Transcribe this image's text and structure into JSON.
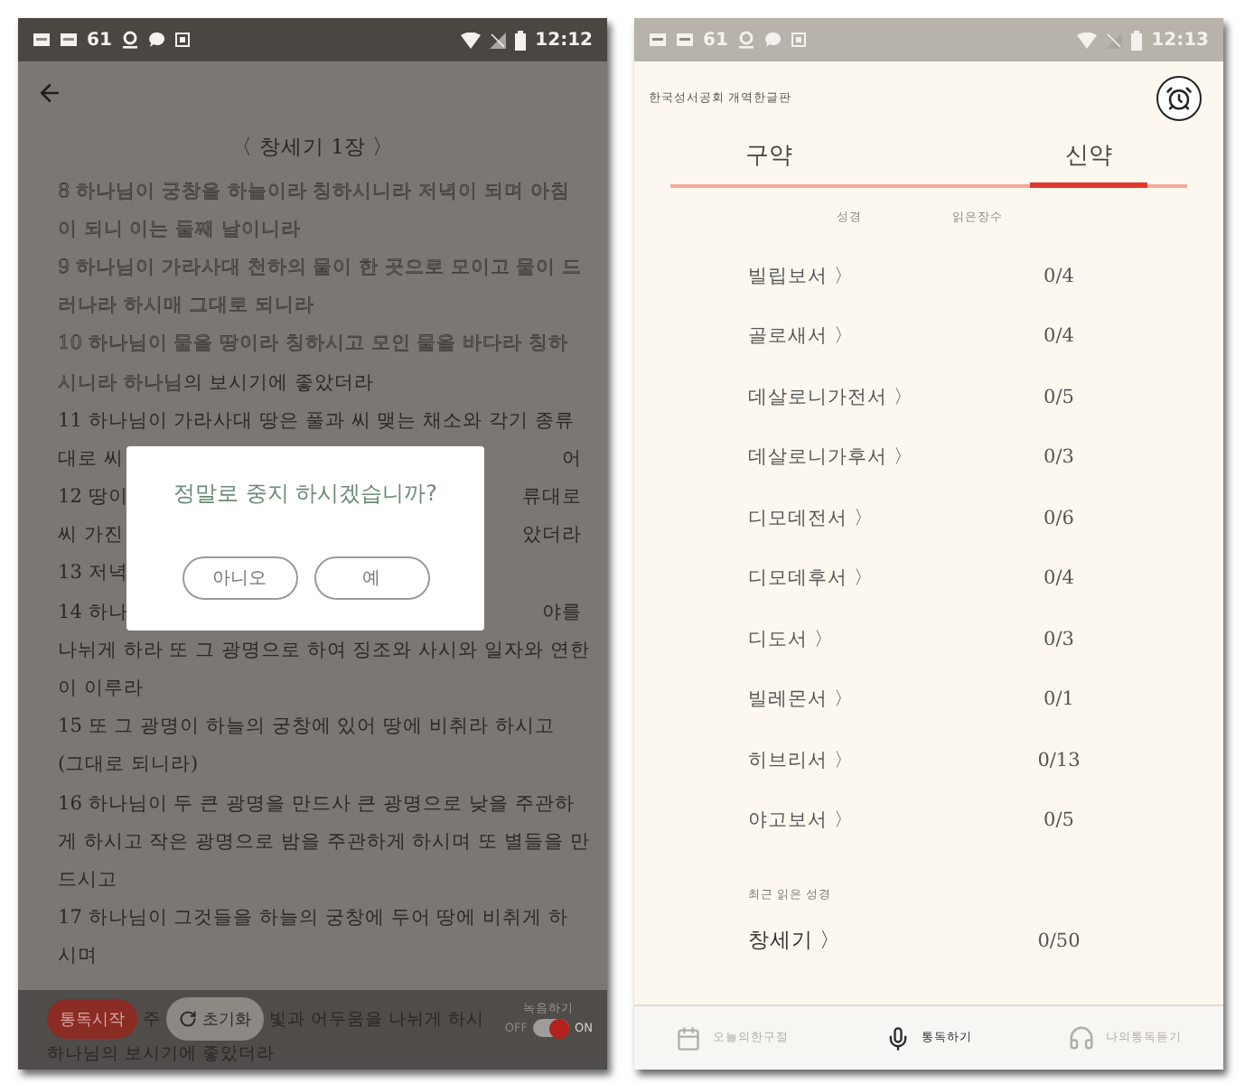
{
  "reading_screen": {
    "status_bar": {
      "count": "61",
      "time": "12:12"
    },
    "title": "〈 창세기 1장 〉",
    "lines": [
      {
        "kind": "full",
        "read": "8  하나님이 궁창을 하늘이라 칭하시니라 저녁이 되며 아침"
      },
      {
        "kind": "full",
        "read": "이 되니 이는 둘째 날이니라"
      },
      {
        "kind": "full",
        "read": "9  하나님이 가라사대 천하의 물이 한 곳으로 모이고 뭍이 드"
      },
      {
        "kind": "full",
        "read": "러나라 하시매 그대로 되니라"
      },
      {
        "kind": "full",
        "read": "10  하나님이 뭍을 땅이라 칭하시고 모인 물을 바다라 칭하"
      },
      {
        "kind": "full",
        "read": "시니라 하나님",
        "text": "의 보시기에 좋았더라"
      },
      {
        "kind": "full",
        "text": "11  하나님이 가라사대 땅은 풀과 씨 맺는 채소와 각기 종류"
      },
      {
        "kind": "covered",
        "text": "대로 씨",
        "right": "어"
      },
      {
        "kind": "covered",
        "text": "12  땅이",
        "right": "류대로"
      },
      {
        "kind": "covered",
        "text": "씨 가진",
        "right": "았더라"
      },
      {
        "kind": "covered",
        "text": "13  저녁"
      },
      {
        "kind": "covered",
        "text": "14  하나",
        "right": "야를"
      },
      {
        "kind": "full",
        "text": "나뉘게 하라 또 그 광명으로 하여 징조와 사시와 일자와 연한"
      },
      {
        "kind": "full",
        "text": "이 이루라"
      },
      {
        "kind": "full",
        "text": "15  또 그 광명이 하늘의 궁창에 있어 땅에 비취라 하시고"
      },
      {
        "kind": "full",
        "text": "(그대로 되니라)"
      },
      {
        "kind": "full",
        "text": "16  하나님이 두 큰 광명을 만드사 큰 광명으로 낮을 주관하"
      },
      {
        "kind": "full",
        "text": "게 하시고 작은 광명으로 밤을 주관하게 하시며 또 별들을 만"
      },
      {
        "kind": "full",
        "text": "드시고"
      },
      {
        "kind": "full",
        "text": "17  하나님이 그것들을 하늘의 궁창에 두어 땅에 비취게 하"
      },
      {
        "kind": "full",
        "text": "시며"
      }
    ],
    "dialog": {
      "message": "정말로 중지 하시겠습니까?",
      "buttons": [
        "아니오",
        "예"
      ]
    },
    "bottom_bar": {
      "start_button": "통독시작",
      "fragment_1": "주",
      "reset_button": "초기화",
      "fragment_2": "빛과 어두움을 나뉘게 하시",
      "record_label": "녹음하기",
      "toggle": {
        "off_label": "OFF",
        "on_label": "ON",
        "on": true
      },
      "last_line": "하나님의 보시기에 좋았더라"
    }
  },
  "books_screen": {
    "status_bar": {
      "count": "61",
      "time": "12:13"
    },
    "publisher": "한국성서공회 개역한글판",
    "tabs": [
      {
        "label": "구약",
        "selected": false
      },
      {
        "label": "신약",
        "selected": true
      }
    ],
    "columns": [
      "성경",
      "읽은장수"
    ],
    "books": [
      {
        "name": "빌립보서 〉",
        "count": "0/4"
      },
      {
        "name": "골로새서 〉",
        "count": "0/4"
      },
      {
        "name": "데살로니가전서 〉",
        "count": "0/5"
      },
      {
        "name": "데살로니가후서 〉",
        "count": "0/3"
      },
      {
        "name": "디모데전서 〉",
        "count": "0/6"
      },
      {
        "name": "디모데후서 〉",
        "count": "0/4"
      },
      {
        "name": "디도서 〉",
        "count": "0/3"
      },
      {
        "name": "빌레몬서 〉",
        "count": "0/1"
      },
      {
        "name": "히브리서 〉",
        "count": "0/13"
      },
      {
        "name": "야고보서 〉",
        "count": "0/5"
      }
    ],
    "recent_label": "최근 읽은 성경",
    "recent": {
      "name": "창세기 〉",
      "count": "0/50"
    },
    "nav": [
      {
        "kind": "calendar",
        "label": "오늘의한구절",
        "selected": false
      },
      {
        "kind": "mic",
        "label": "통독하기",
        "selected": true
      },
      {
        "kind": "headphones",
        "label": "나의통독듣기",
        "selected": false
      }
    ]
  }
}
